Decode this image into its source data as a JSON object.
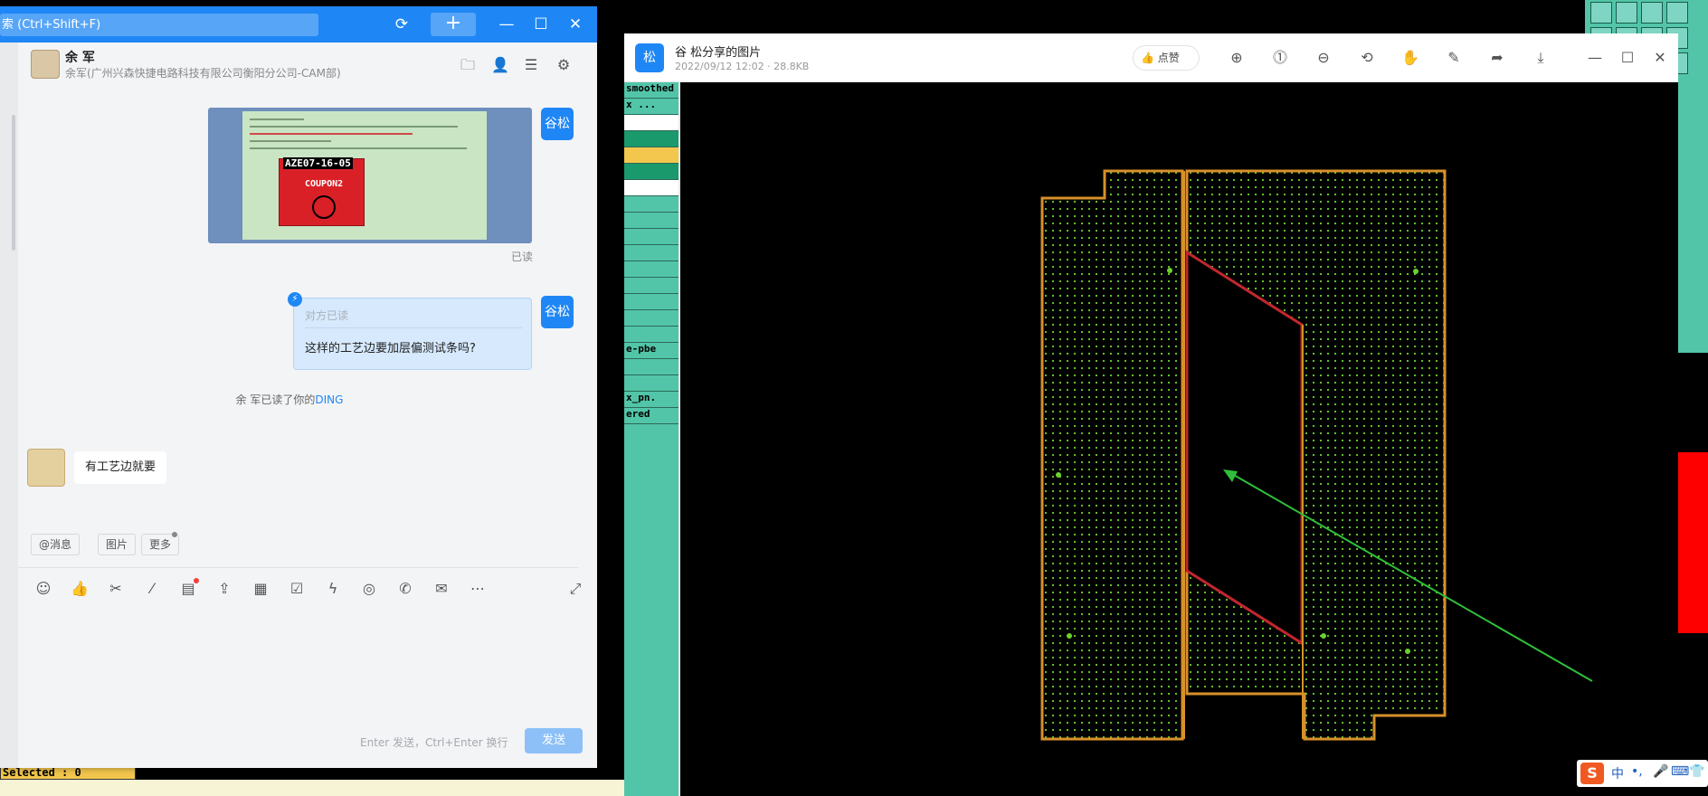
{
  "chat": {
    "search_placeholder": "索 (Ctrl+Shift+F)",
    "add_label": "+",
    "contact": {
      "name": "余 军",
      "org": "余军(广州兴森快捷电路科技有限公司衡阳分公司-CAM部)"
    },
    "my_avatar_text": "谷松",
    "image_read_status": "已读",
    "ding_bubble": {
      "status": "对方已读",
      "text": "这样的工艺边要加层偏测试条吗?"
    },
    "ding_notice": {
      "prefix": "余 军已读了你的",
      "ding": "DING"
    },
    "reply_text": "有工艺边就要",
    "quick_actions": [
      "@消息",
      "图片",
      "更多"
    ],
    "input_hint": "Enter 发送，Ctrl+Enter 换行",
    "send_label": "发送",
    "image_preview": {
      "code": "AZE07-16-05",
      "coupon": "COUPON2"
    }
  },
  "viewer": {
    "avatar_text": "松",
    "title": "谷 松分享的图片",
    "meta": "2022/09/12 12:02 · 28.8KB",
    "like_label": "点赞"
  },
  "background": {
    "status_text": "Selected : 0",
    "list_rows": [
      "smoothed",
      "x ...",
      "",
      "",
      "",
      "",
      "",
      "",
      "",
      "",
      "",
      "",
      "",
      "",
      "",
      "",
      "e-pbe",
      "",
      "",
      "x_pn.",
      "ered"
    ]
  },
  "ime": {
    "logo": "S",
    "items": [
      "中",
      "•,",
      "🎤",
      "⌨",
      "👕"
    ]
  },
  "colors": {
    "accent": "#1f87f5",
    "cam_teal": "#52c5a8",
    "pcb_outline": "#d8902a",
    "pcb_dots": "#6bd12f",
    "arrow": "#2fbf3a"
  }
}
